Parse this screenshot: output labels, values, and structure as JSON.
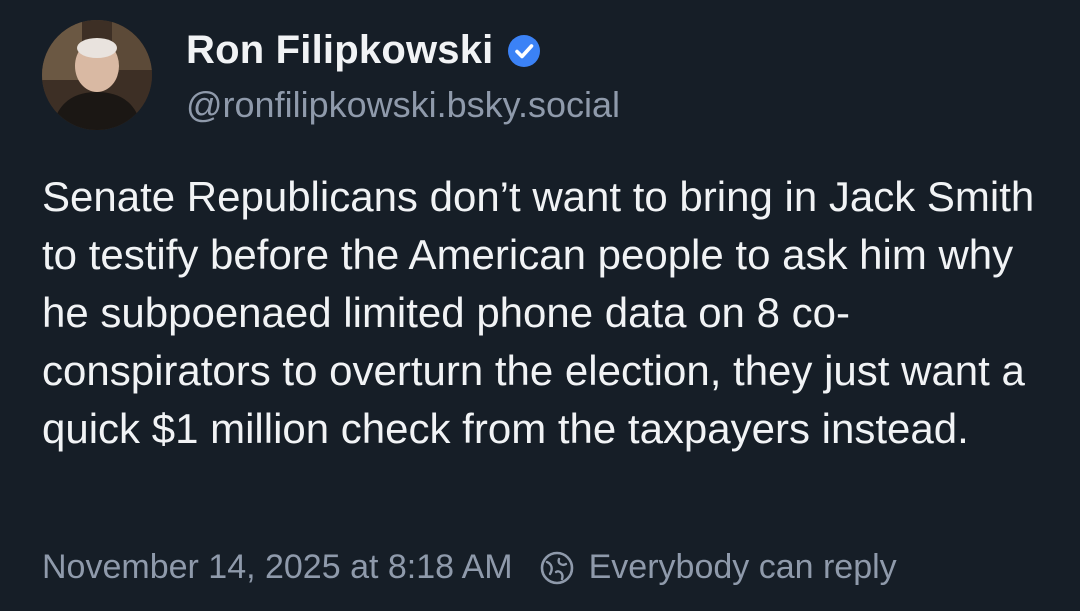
{
  "post": {
    "author": {
      "display_name": "Ron Filipkowski",
      "handle": "@ronfilipkowski.bsky.social",
      "verified": true,
      "avatar_icon": "avatar-photo"
    },
    "text": "Senate Republicans don’t want to bring in Jack Smith to testify before the American people to ask him why he subpoenaed limited phone data on 8 co-conspirators to overturn the election, they just want a quick $1 million check from the taxpayers instead.",
    "timestamp": "November 14, 2025 at 8:18 AM",
    "reply_setting": "Everybody can reply",
    "reply_icon": "globe-icon"
  },
  "colors": {
    "background": "#161e27",
    "text_primary": "#f1f3f5",
    "text_secondary": "#8f9aab",
    "verified": "#3b82f6"
  }
}
